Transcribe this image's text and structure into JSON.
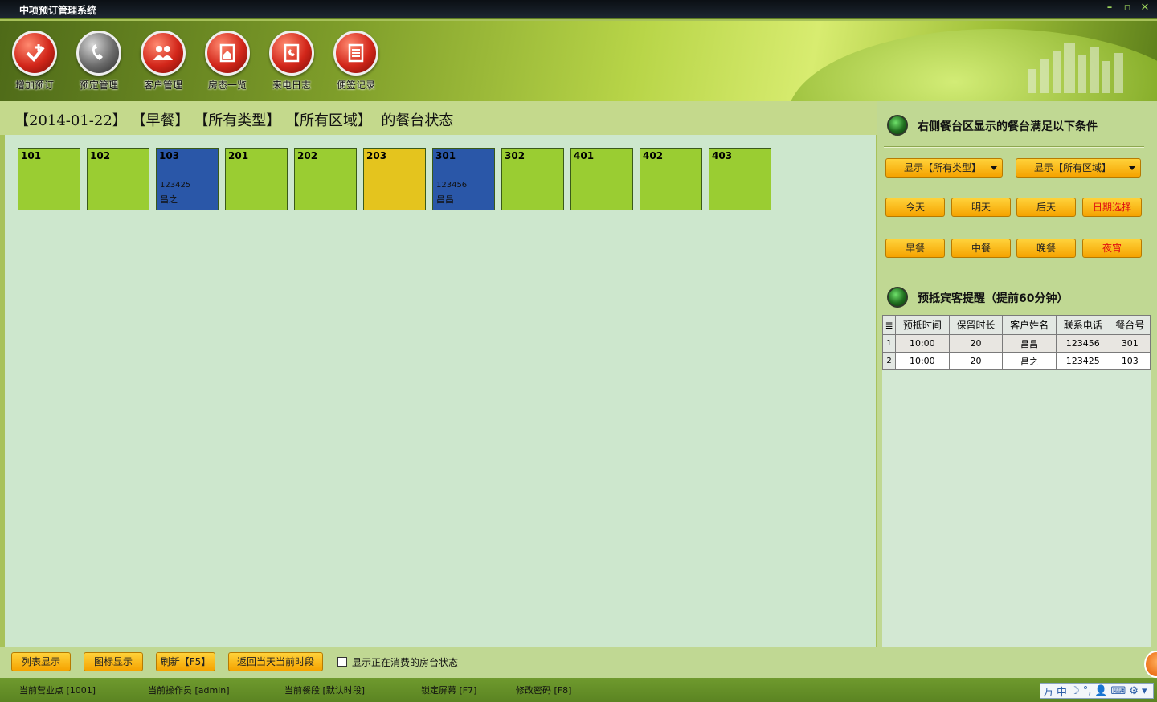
{
  "window": {
    "title": "中项预订管理系统",
    "controls": [
      "–",
      "▫",
      "✕"
    ]
  },
  "toolbar": [
    {
      "label": "增加预订",
      "icon": "add-booking-icon"
    },
    {
      "label": "预定管理",
      "icon": "phone-icon"
    },
    {
      "label": "客户管理",
      "icon": "customers-icon"
    },
    {
      "label": "房态一览",
      "icon": "room-status-icon"
    },
    {
      "label": "来电日志",
      "icon": "call-log-icon"
    },
    {
      "label": "便签记录",
      "icon": "notes-icon"
    }
  ],
  "status_line": "【2014-01-22】 【早餐】 【所有类型】 【所有区域】  的餐台状态",
  "tables": [
    {
      "no": "101",
      "tel": "",
      "name": "",
      "color": "#9acd32"
    },
    {
      "no": "102",
      "tel": "",
      "name": "",
      "color": "#9acd32"
    },
    {
      "no": "103",
      "tel": "123425",
      "name": "昌之",
      "color": "#2a57a8"
    },
    {
      "no": "201",
      "tel": "",
      "name": "",
      "color": "#9acd32"
    },
    {
      "no": "202",
      "tel": "",
      "name": "",
      "color": "#9acd32"
    },
    {
      "no": "203",
      "tel": "",
      "name": "",
      "color": "#e4c41e"
    },
    {
      "no": "301",
      "tel": "123456",
      "name": "昌昌",
      "color": "#2a57a8"
    },
    {
      "no": "302",
      "tel": "",
      "name": "",
      "color": "#9acd32"
    },
    {
      "no": "401",
      "tel": "",
      "name": "",
      "color": "#9acd32"
    },
    {
      "no": "402",
      "tel": "",
      "name": "",
      "color": "#9acd32"
    },
    {
      "no": "403",
      "tel": "",
      "name": "",
      "color": "#9acd32"
    }
  ],
  "right": {
    "filter_title": "右侧餐台区显示的餐台满足以下条件",
    "type_select": "显示【所有类型】",
    "area_select": "显示【所有区域】",
    "days": [
      "今天",
      "明天",
      "后天",
      "日期选择"
    ],
    "meals": [
      "早餐",
      "中餐",
      "晚餐",
      "夜宵"
    ],
    "reminder_title": "预抵宾客提醒（提前60分钟）",
    "grid_headers": [
      "预抵时间",
      "保留时长",
      "客户姓名",
      "联系电话",
      "餐台号"
    ],
    "grid_rows": [
      {
        "idx": "1",
        "cells": [
          "10:00",
          "20",
          "昌昌",
          "123456",
          "301"
        ]
      },
      {
        "idx": "2",
        "cells": [
          "10:00",
          "20",
          "昌之",
          "123425",
          "103"
        ]
      }
    ]
  },
  "bottom": {
    "list_view": "列表显示",
    "icon_view": "图标显示",
    "refresh": "刷新【F5】",
    "back_current": "返回当天当前时段",
    "show_consuming": "显示正在消费的房台状态"
  },
  "footer": {
    "business_point": "当前营业点 [1001]",
    "operator": "当前操作员 [admin]",
    "meal_period": "当前餐段 [默认时段]",
    "lock_screen": "锁定屏幕 [F7]",
    "change_password": "修改密码 [F8]"
  },
  "ime": [
    "万",
    "中",
    "☽",
    "°,",
    "👤",
    "⌨",
    "⚙",
    "▾"
  ],
  "colors": {
    "available": "#9acd32",
    "booked": "#2a57a8",
    "reserved_other": "#e4c41e",
    "panel_bg": "#cde7cd",
    "button": "#f5a300",
    "date_select_text": "#e01010"
  }
}
